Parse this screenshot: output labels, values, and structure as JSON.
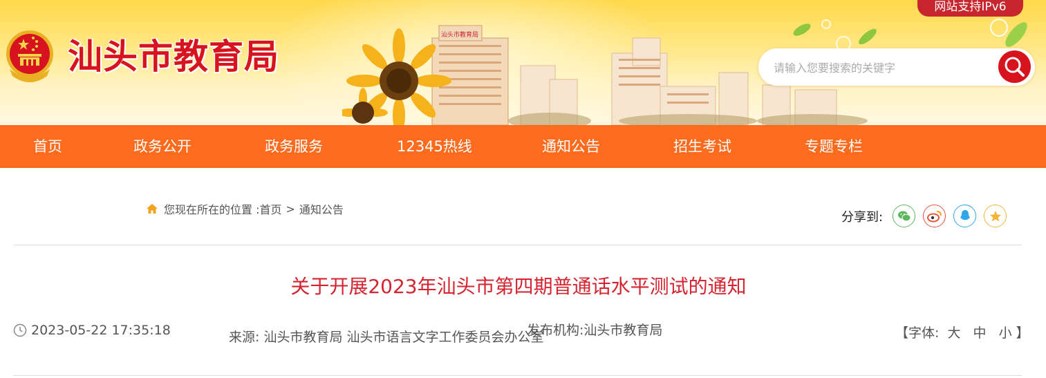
{
  "header": {
    "site_title": "汕头市教育局",
    "ipv6_badge": "网站支持IPv6",
    "search_placeholder": "请输入您要搜索的关键字",
    "building_sign": "汕头市教育局"
  },
  "nav": {
    "items": [
      "首页",
      "政务公开",
      "政务服务",
      "12345热线",
      "通知公告",
      "招生考试",
      "专题专栏"
    ]
  },
  "breadcrumb": {
    "prefix": "您现在所在的位置 : ",
    "home": "首页",
    "separator": ">",
    "current": "通知公告"
  },
  "share": {
    "label": "分享到:",
    "icons": [
      "wechat-icon",
      "weibo-icon",
      "qq-icon",
      "qzone-icon"
    ]
  },
  "article": {
    "title": "关于开展2023年汕头市第四期普通话水平测试的通知",
    "date": "2023-05-22 17:35:18",
    "source_label": "来源:",
    "source_value": "汕头市教育局 汕头市语言文字工作委员会办公室",
    "publisher_label": "发布机构:",
    "publisher_value": "汕头市教育局",
    "font_label": "【字体:",
    "font_large": "大",
    "font_medium": "中",
    "font_small": "小",
    "font_close": "】"
  },
  "colors": {
    "nav_bg": "#fc6b1e",
    "title_red": "#d5232f",
    "brand_red": "#d6131f"
  }
}
